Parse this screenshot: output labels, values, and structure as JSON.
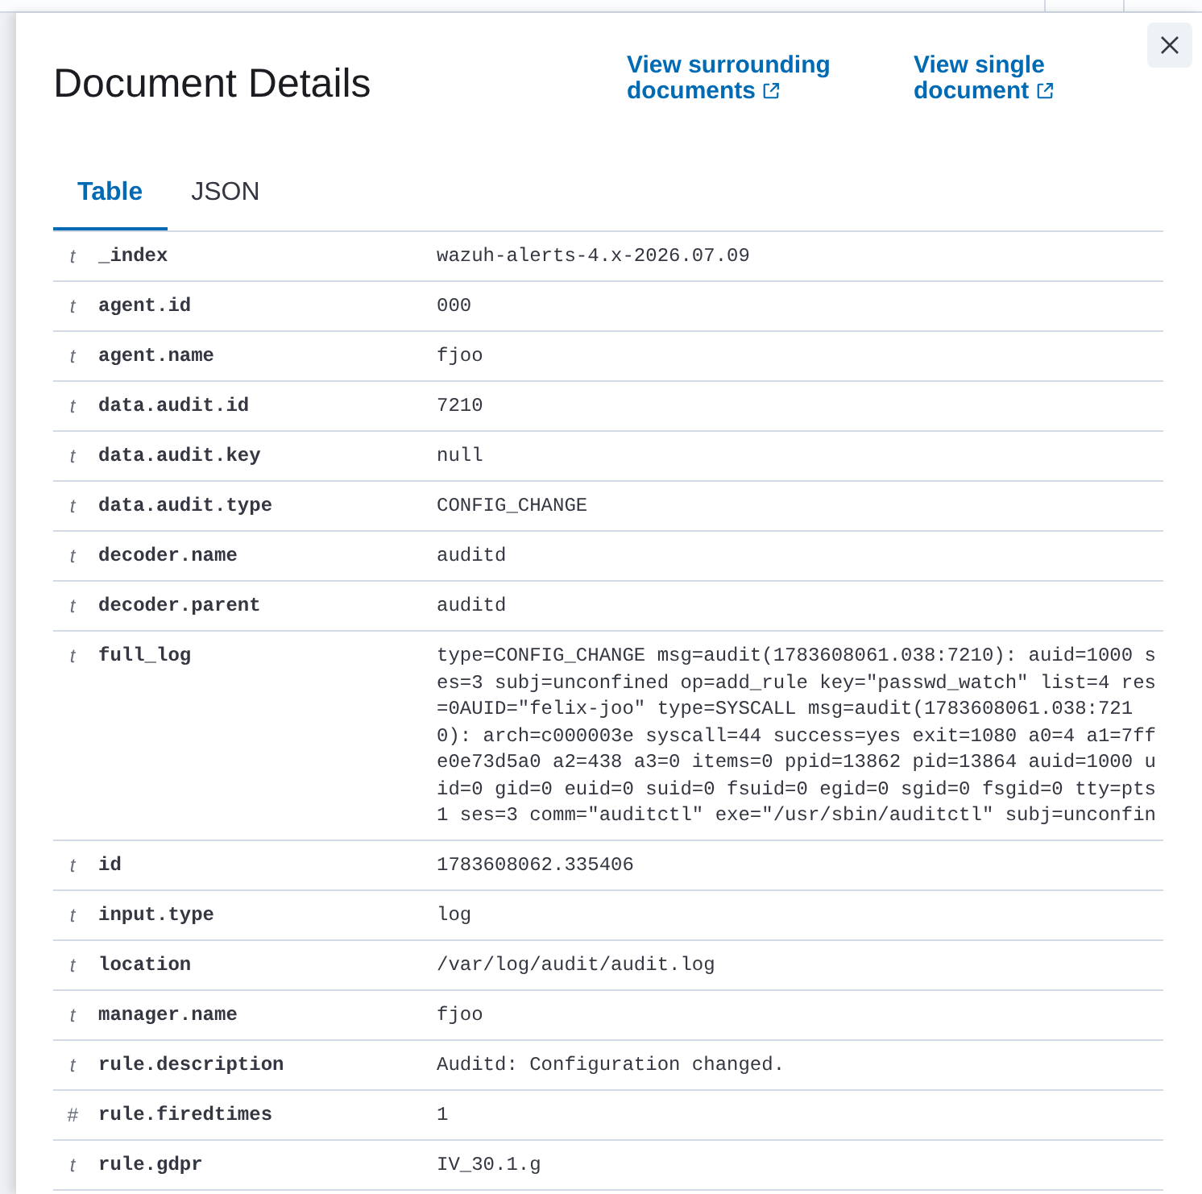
{
  "flyout": {
    "title": "Document Details",
    "links": [
      {
        "label": "View surrounding documents"
      },
      {
        "label": "View single document"
      }
    ]
  },
  "tabs": [
    {
      "label": "Table",
      "selected": true
    },
    {
      "label": "JSON",
      "selected": false
    }
  ],
  "fields": [
    {
      "type_icon": "t",
      "name": "_index",
      "value": "wazuh-alerts-4.x-2026.07.09"
    },
    {
      "type_icon": "t",
      "name": "agent.id",
      "value": "000"
    },
    {
      "type_icon": "t",
      "name": "agent.name",
      "value": "fjoo"
    },
    {
      "type_icon": "t",
      "name": "data.audit.id",
      "value": "7210"
    },
    {
      "type_icon": "t",
      "name": "data.audit.key",
      "value": "null"
    },
    {
      "type_icon": "t",
      "name": "data.audit.type",
      "value": "CONFIG_CHANGE"
    },
    {
      "type_icon": "t",
      "name": "decoder.name",
      "value": "auditd"
    },
    {
      "type_icon": "t",
      "name": "decoder.parent",
      "value": "auditd"
    },
    {
      "type_icon": "t",
      "name": "full_log",
      "value": "type=CONFIG_CHANGE msg=audit(1783608061.038:7210): auid=1000 ses=3 subj=unconfined op=add_rule key=\"passwd_watch\" list=4 res=0AUID=\"felix-joo\" type=SYSCALL msg=audit(1783608061.038:7210): arch=c000003e syscall=44 success=yes exit=1080 a0=4 a1=7ffe0e73d5a0 a2=438 a3=0 items=0 ppid=13862 pid=13864 auid=1000 uid=0 gid=0 euid=0 suid=0 fsuid=0 egid=0 sgid=0 fsgid=0 tty=pts1 ses=3 comm=\"auditctl\" exe=\"/usr/sbin/auditctl\" subj=unconfin"
    },
    {
      "type_icon": "t",
      "name": "id",
      "value": "1783608062.335406"
    },
    {
      "type_icon": "t",
      "name": "input.type",
      "value": "log"
    },
    {
      "type_icon": "t",
      "name": "location",
      "value": "/var/log/audit/audit.log"
    },
    {
      "type_icon": "t",
      "name": "manager.name",
      "value": "fjoo"
    },
    {
      "type_icon": "t",
      "name": "rule.description",
      "value": "Auditd: Configuration changed."
    },
    {
      "type_icon": "#",
      "name": "rule.firedtimes",
      "value": "1"
    },
    {
      "type_icon": "t",
      "name": "rule.gdpr",
      "value": "IV_30.1.g"
    }
  ]
}
